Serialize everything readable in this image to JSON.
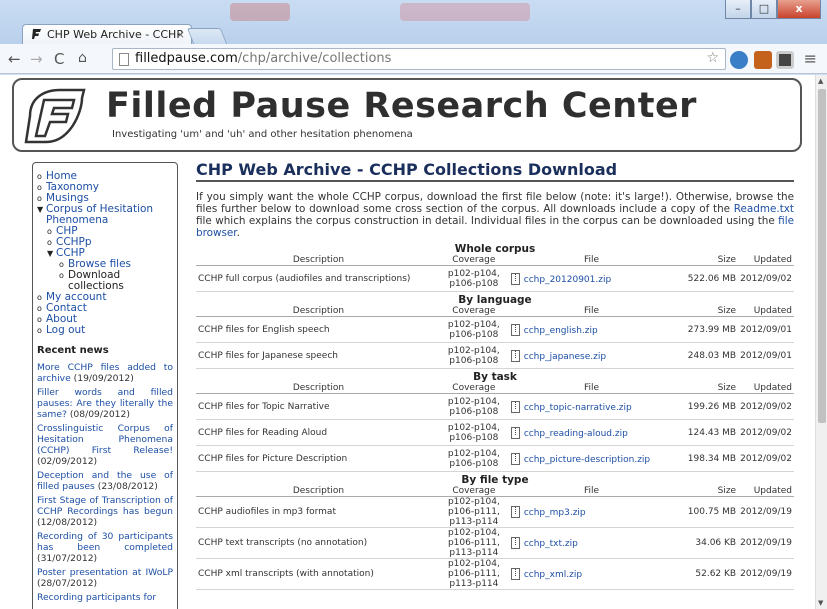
{
  "browser": {
    "tab_title": "CHP Web Archive - CCHP",
    "tab_close": "×",
    "address_host": "filledpause.com",
    "address_path": "/chp/archive/collections",
    "window_buttons": {
      "minimize": "–",
      "maximize": "□",
      "close": "x"
    },
    "icons": [
      "back-icon",
      "forward-icon",
      "reload-icon",
      "home-icon",
      "star-icon",
      "menu-icon"
    ]
  },
  "header": {
    "title": "Filled Pause Research Center",
    "tagline": "Investigating 'um' and 'uh' and other hesitation phenomena"
  },
  "sidebar": {
    "nav": {
      "home": "Home",
      "taxonomy": "Taxonomy",
      "musings": "Musings",
      "corpus": "Corpus of Hesitation Phenomena",
      "chp": "CHP",
      "cchpp": "CCHPp",
      "cchp": "CCHP",
      "browse_files": "Browse files",
      "download_collections": "Download collections",
      "my_account": "My account",
      "contact": "Contact",
      "about": "About",
      "log_out": "Log out"
    },
    "recent_news_heading": "Recent news",
    "news": [
      {
        "title": "More CCHP files added to archive",
        "date": "(19/09/2012)"
      },
      {
        "title": "Filler words and filled pauses: Are they literally the same?",
        "date": "(08/09/2012)"
      },
      {
        "title": "Crosslinguistic Corpus of Hesitation Phenomena (CCHP) First Release!",
        "date": "(02/09/2012)"
      },
      {
        "title": "Deception and the use of filled pauses",
        "date": "(23/08/2012)"
      },
      {
        "title": "First Stage of Transcription of CCHP Recordings has begun",
        "date": "(12/08/2012)"
      },
      {
        "title": "Recording of 30 participants has been completed",
        "date": "(31/07/2012)"
      },
      {
        "title": "Poster presentation at IWoLP",
        "date": "(28/07/2012)"
      },
      {
        "title": "Recording participants for",
        "date": ""
      }
    ]
  },
  "main": {
    "heading": "CHP Web Archive - CCHP Collections Download",
    "intro_before": "If you simply want the whole CCHP corpus, download the first file below (note: it's large!). Otherwise, browse the files further below to download some cross section of the corpus. All downloads include a copy of the ",
    "intro_readme": "Readme.txt",
    "intro_middle": " file which explains the corpus construction in detail. Individual files in the corpus can be downloaded using the ",
    "intro_browser": "file browser",
    "intro_end": ".",
    "columns": {
      "description": "Description",
      "coverage": "Coverage",
      "file": "File",
      "size": "Size",
      "updated": "Updated"
    },
    "sections": [
      {
        "title": "Whole corpus",
        "rows": [
          {
            "description": "CCHP full corpus (audiofiles and transcriptions)",
            "coverage": [
              "p102-p104,",
              "p106-p108"
            ],
            "file": "cchp_20120901.zip",
            "size": "522.06 MB",
            "updated": "2012/09/02"
          }
        ]
      },
      {
        "title": "By language",
        "rows": [
          {
            "description": "CCHP files for English speech",
            "coverage": [
              "p102-p104,",
              "p106-p108"
            ],
            "file": "cchp_english.zip",
            "size": "273.99 MB",
            "updated": "2012/09/01"
          },
          {
            "description": "CCHP files for Japanese speech",
            "coverage": [
              "p102-p104,",
              "p106-p108"
            ],
            "file": "cchp_japanese.zip",
            "size": "248.03 MB",
            "updated": "2012/09/01"
          }
        ]
      },
      {
        "title": "By task",
        "rows": [
          {
            "description": "CCHP files for Topic Narrative",
            "coverage": [
              "p102-p104,",
              "p106-p108"
            ],
            "file": "cchp_topic-narrative.zip",
            "size": "199.26 MB",
            "updated": "2012/09/02"
          },
          {
            "description": "CCHP files for Reading Aloud",
            "coverage": [
              "p102-p104,",
              "p106-p108"
            ],
            "file": "cchp_reading-aloud.zip",
            "size": "124.43 MB",
            "updated": "2012/09/02"
          },
          {
            "description": "CCHP files for Picture Description",
            "coverage": [
              "p102-p104,",
              "p106-p108"
            ],
            "file": "cchp_picture-description.zip",
            "size": "198.34 MB",
            "updated": "2012/09/02"
          }
        ]
      },
      {
        "title": "By file type",
        "rows": [
          {
            "description": "CCHP audiofiles in mp3 format",
            "coverage": [
              "p102-p104,",
              "p106-p111,",
              "p113-p114"
            ],
            "file": "cchp_mp3.zip",
            "size": "100.75 MB",
            "updated": "2012/09/19"
          },
          {
            "description": "CCHP text transcripts (no annotation)",
            "coverage": [
              "p102-p104,",
              "p106-p111,",
              "p113-p114"
            ],
            "file": "cchp_txt.zip",
            "size": "34.06 KB",
            "updated": "2012/09/19"
          },
          {
            "description": "CCHP xml transcripts (with annotation)",
            "coverage": [
              "p102-p104,",
              "p106-p111,",
              "p113-p114"
            ],
            "file": "cchp_xml.zip",
            "size": "52.62 KB",
            "updated": "2012/09/19"
          }
        ]
      }
    ]
  },
  "colors": {
    "link": "#1d4fa5",
    "heading": "#1a2f5c",
    "frame": "#cfe0f3"
  }
}
